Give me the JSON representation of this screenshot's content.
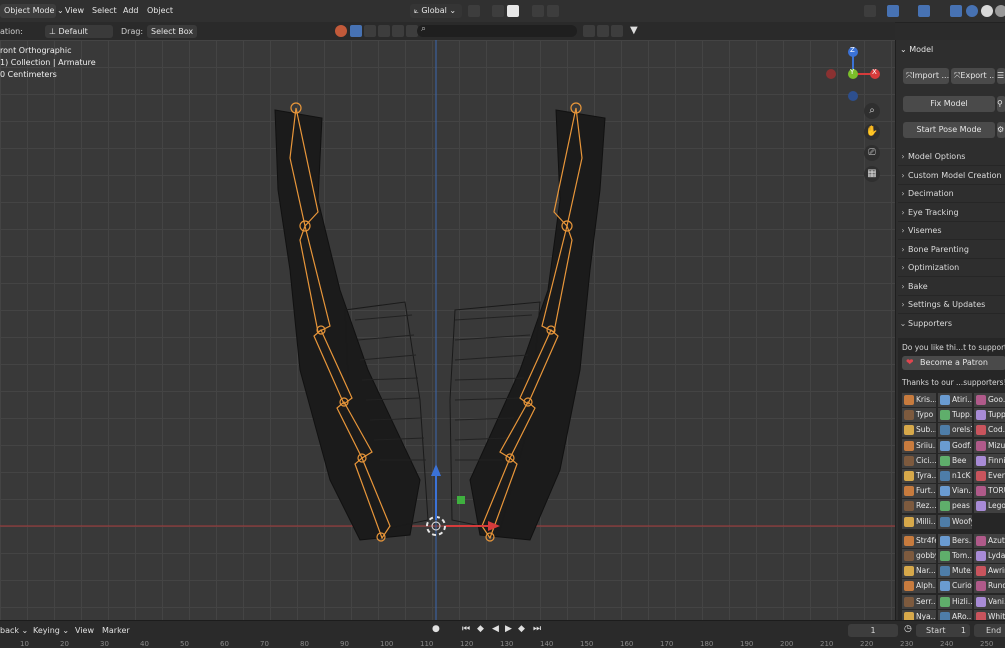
{
  "header": {
    "mode": "Object Mode",
    "menus": [
      "View",
      "Select",
      "Add",
      "Object"
    ],
    "transform_orientation": "Global"
  },
  "toolbar": {
    "orientation_label": "ation:",
    "orientation_value": "Default",
    "drag_label": "Drag:",
    "drag_value": "Select Box"
  },
  "viewport": {
    "view_name": "ront Orthographic",
    "collection": "1) Collection | Armature",
    "scale": "0 Centimeters",
    "gizmo": {
      "z": "Z",
      "y": "Y",
      "x": "X"
    }
  },
  "sidebar": {
    "panel_title": "Model",
    "import_label": "Import ...",
    "export_label": "Export ...",
    "fix_model_label": "Fix Model",
    "start_pose_label": "Start Pose Mode",
    "sections": [
      "Model Options",
      "Custom Model Creation",
      "Decimation",
      "Eye Tracking",
      "Visemes",
      "Bone Parenting",
      "Optimization",
      "Bake",
      "Settings & Updates"
    ],
    "supporters_title": "Supporters",
    "support_text": "Do you like thi...t to support us",
    "patron_label": "Become a Patron",
    "thanks_text": "Thanks to our ...supporters! <3",
    "supporters": [
      [
        "Kris...",
        "Atiri...",
        "Goo..."
      ],
      [
        "Typo",
        "Tupp...",
        "Tupp..."
      ],
      [
        "Sub...",
        "orels1",
        "Cod..."
      ],
      [
        "Sriiu...",
        "Godf...",
        "Mizu..."
      ],
      [
        "Cici...",
        "Bee",
        "Finni..."
      ],
      [
        "Tyra...",
        "n1cK",
        "Even..."
      ],
      [
        "Furt...",
        "Vian...",
        "TORU..."
      ],
      [
        "Rez...",
        "peas",
        "Lego..."
      ],
      [
        "Milli...",
        "Woofy",
        ""
      ],
      [
        "Str4fe",
        "Bers...",
        "Azut..."
      ],
      [
        "gobby",
        "Tom...",
        "Lyda..."
      ],
      [
        "Nar...",
        "Mute...",
        "Awrin..."
      ],
      [
        "Alph...",
        "Curio",
        "Rund..."
      ],
      [
        "Serr...",
        "Hizli...",
        "Vani..."
      ],
      [
        "Nya...",
        "ARo...",
        "Whit..."
      ]
    ],
    "colors": {
      "accent": "#4772b3",
      "patron": "#e0454e"
    }
  },
  "timeline": {
    "playback": "back",
    "keying": "Keying",
    "view": "View",
    "marker": "Marker",
    "current_frame": "1",
    "start_label": "Start",
    "start_value": "1",
    "end_label": "End",
    "ticks": [
      "10",
      "20",
      "30",
      "40",
      "50",
      "60",
      "70",
      "80",
      "90",
      "100",
      "110",
      "120",
      "130",
      "140",
      "150",
      "160",
      "170",
      "180",
      "190",
      "200",
      "210",
      "220",
      "230",
      "240",
      "250"
    ]
  }
}
